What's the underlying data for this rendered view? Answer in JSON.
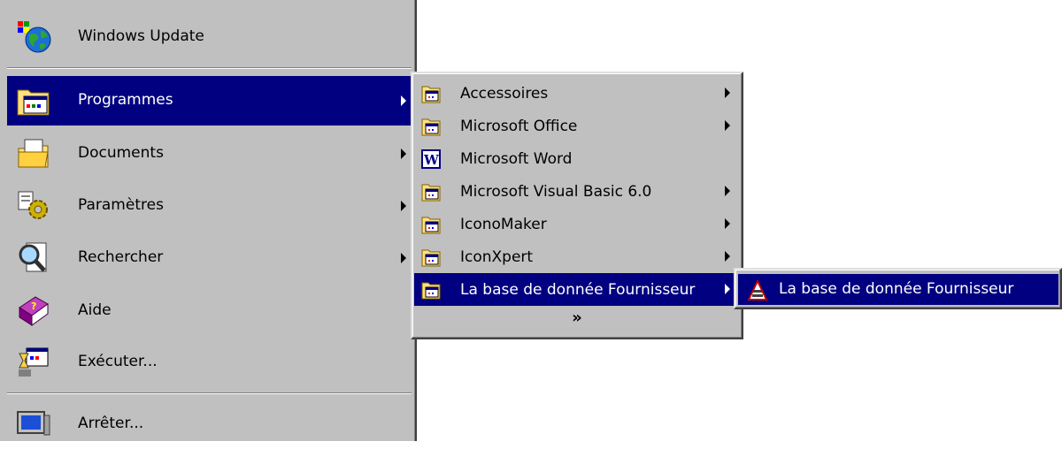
{
  "start_menu": {
    "items": [
      {
        "label": "Windows Update",
        "icon": "windows-update-globe-icon",
        "has_submenu": false
      },
      {
        "label": "Programmes",
        "icon": "programs-folder-icon",
        "has_submenu": true,
        "selected": true
      },
      {
        "label": "Documents",
        "icon": "documents-folder-icon",
        "has_submenu": true
      },
      {
        "label": "Paramètres",
        "icon": "settings-gear-icon",
        "has_submenu": true
      },
      {
        "label": "Rechercher",
        "icon": "search-magnifier-icon",
        "has_submenu": true
      },
      {
        "label": "Aide",
        "icon": "help-book-icon",
        "has_submenu": false
      },
      {
        "label": "Exécuter...",
        "icon": "run-icon",
        "has_submenu": false
      },
      {
        "label": "Arrêter...",
        "icon": "shutdown-computer-icon",
        "has_submenu": false
      }
    ]
  },
  "programs_menu": {
    "items": [
      {
        "label": "Accessoires",
        "icon": "program-group-icon",
        "has_submenu": true
      },
      {
        "label": "Microsoft Office",
        "icon": "program-group-icon",
        "has_submenu": true
      },
      {
        "label": "Microsoft Word",
        "icon": "word-icon",
        "has_submenu": false
      },
      {
        "label": "Microsoft Visual Basic 6.0",
        "icon": "program-group-icon",
        "has_submenu": true
      },
      {
        "label": "IconoMaker",
        "icon": "program-group-icon",
        "has_submenu": true
      },
      {
        "label": "IconXpert",
        "icon": "program-group-icon",
        "has_submenu": true
      },
      {
        "label": "La base de donnée Fournisseur",
        "icon": "program-group-icon",
        "has_submenu": true,
        "selected": true
      }
    ],
    "more_glyph": "»"
  },
  "fournisseur_menu": {
    "items": [
      {
        "label": "La base de donnée Fournisseur",
        "icon": "database-app-icon",
        "selected": true
      }
    ]
  },
  "colors": {
    "menu_bg": "#c0c0c0",
    "selection_bg": "#000080",
    "selection_text": "#ffffff"
  }
}
